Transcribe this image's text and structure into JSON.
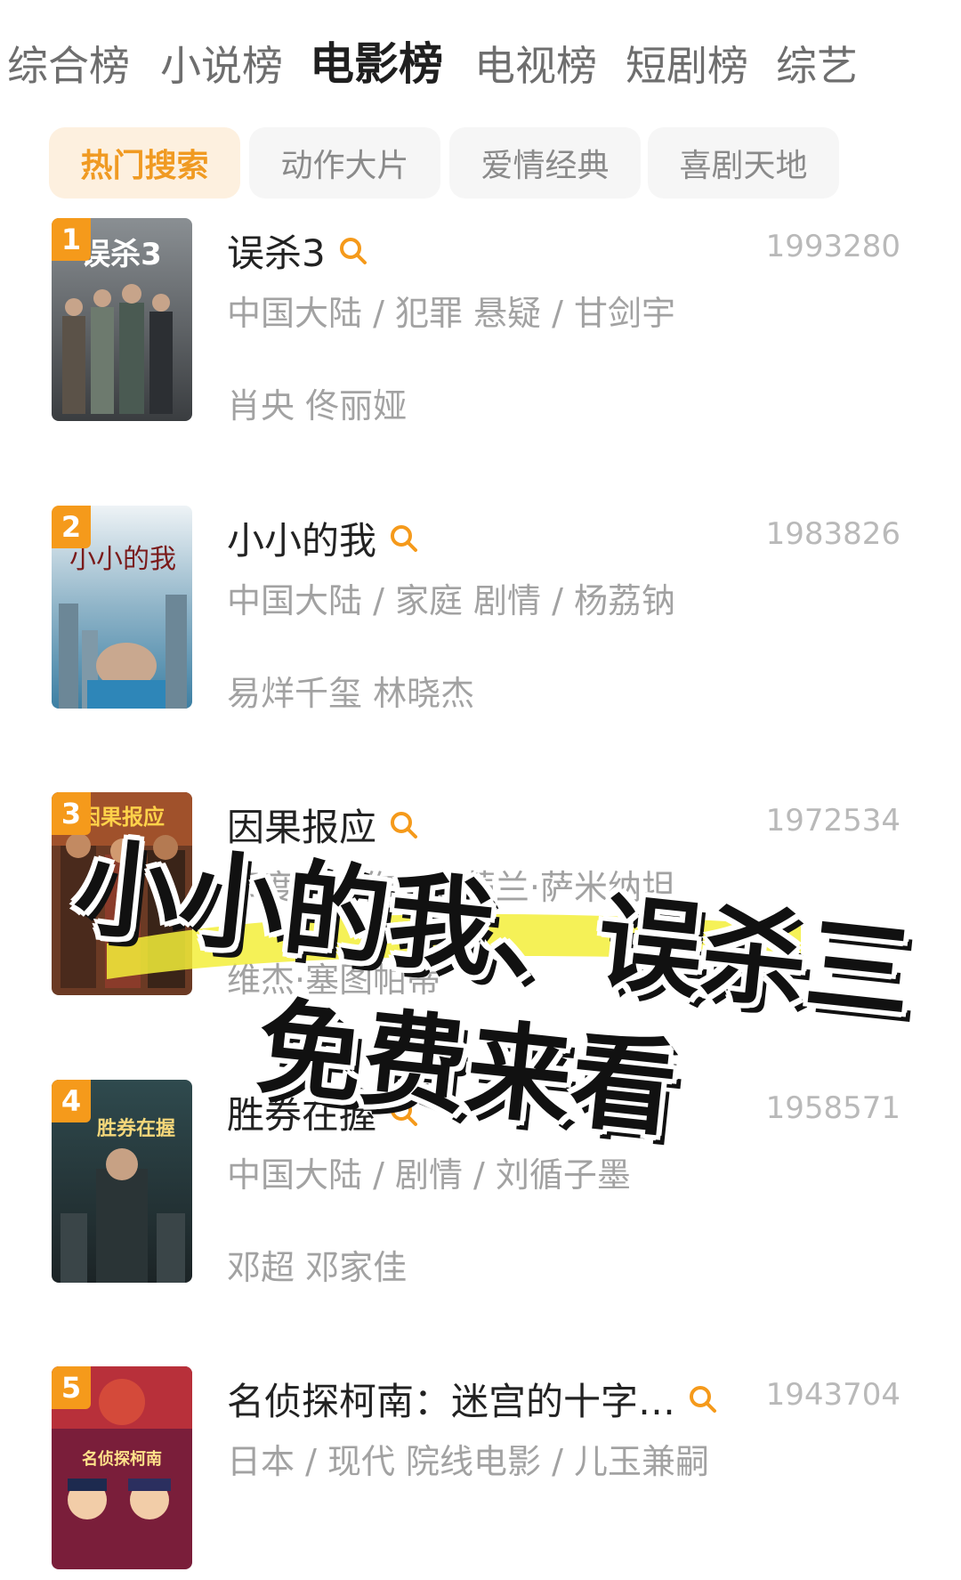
{
  "category_tabs": [
    {
      "label": "综合榜",
      "active": false
    },
    {
      "label": "小说榜",
      "active": false
    },
    {
      "label": "电影榜",
      "active": true
    },
    {
      "label": "电视榜",
      "active": false
    },
    {
      "label": "短剧榜",
      "active": false
    },
    {
      "label": "综艺",
      "active": false
    }
  ],
  "sub_tabs": [
    {
      "label": "热门搜索",
      "active": true
    },
    {
      "label": "动作大片",
      "active": false
    },
    {
      "label": "爱情经典",
      "active": false
    },
    {
      "label": "喜剧天地",
      "active": false
    }
  ],
  "items": [
    {
      "rank": "1",
      "title": "误杀3",
      "score": "1993280",
      "meta": "中国大陆 / 犯罪 悬疑 / 甘剑宇",
      "cast": "肖央 佟丽娅",
      "poster_text": "误杀3"
    },
    {
      "rank": "2",
      "title": "小小的我",
      "score": "1983826",
      "meta": "中国大陆 / 家庭 剧情 / 杨荔钠",
      "cast": "易烊千玺 林晓杰",
      "poster_text": "小小的我"
    },
    {
      "rank": "3",
      "title": "因果报应",
      "score": "1972534",
      "meta": "印度 / 动作 / 尼蒂兰·萨米纳坦",
      "cast": "维杰·塞图帕蒂",
      "poster_text": "因果报应"
    },
    {
      "rank": "4",
      "title": "胜券在握",
      "score": "1958571",
      "meta": "中国大陆 / 剧情 / 刘循子墨",
      "cast": "邓超 邓家佳",
      "poster_text": "胜券在握"
    },
    {
      "rank": "5",
      "title": "名侦探柯南：迷宫的十字…",
      "score": "1943704",
      "meta": "日本 / 现代 院线电影 / 儿玉兼嗣",
      "cast": "",
      "poster_text": "名侦探柯南"
    }
  ],
  "overlay": {
    "line1": "小小的我、误杀三",
    "line2": "免费来看"
  },
  "colors": {
    "accent": "#f59a1b",
    "active_subtab_bg": "#fdf0df"
  }
}
